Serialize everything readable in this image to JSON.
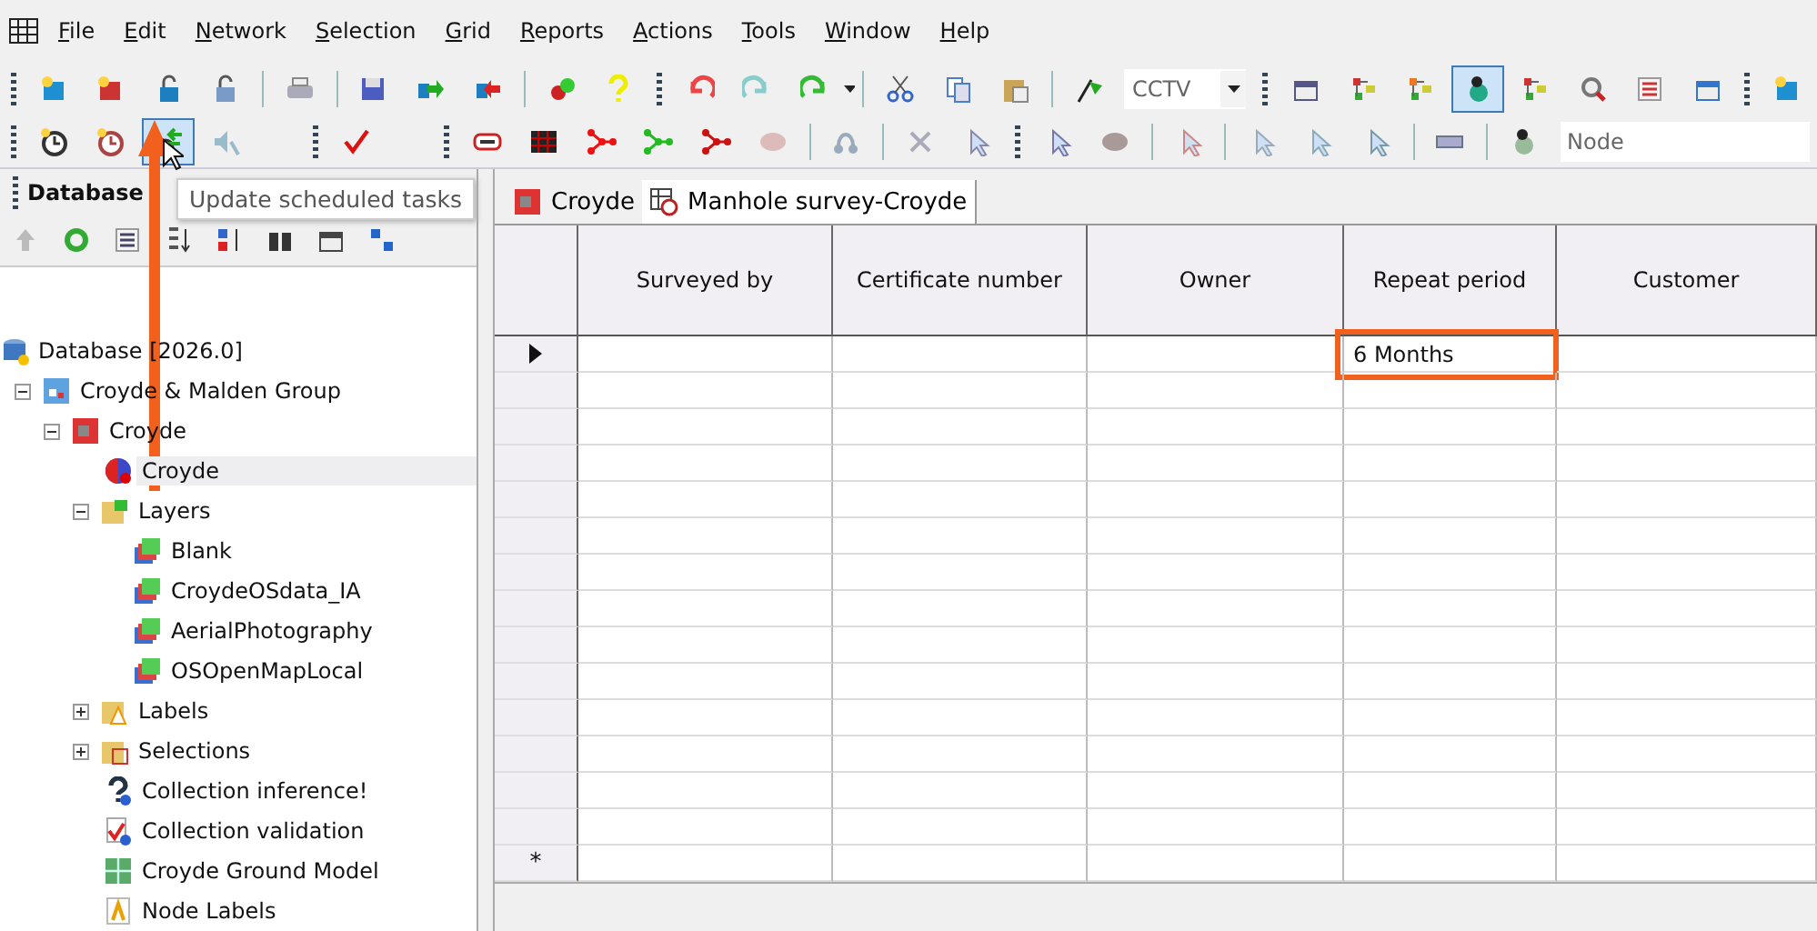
{
  "menu": [
    {
      "label": "File"
    },
    {
      "label": "Edit"
    },
    {
      "label": "Network"
    },
    {
      "label": "Selection"
    },
    {
      "label": "Grid"
    },
    {
      "label": "Reports"
    },
    {
      "label": "Actions"
    },
    {
      "label": "Tools"
    },
    {
      "label": "Window"
    },
    {
      "label": "Help"
    }
  ],
  "toolbars": [
    {
      "items": [
        {
          "kind": "grip"
        },
        {
          "kind": "button",
          "pressed": false
        },
        {
          "kind": "button",
          "pressed": false
        },
        {
          "kind": "button",
          "pressed": false
        },
        {
          "kind": "button",
          "pressed": false
        },
        {
          "kind": "separator"
        },
        {
          "kind": "button",
          "pressed": false
        },
        {
          "kind": "separator"
        },
        {
          "kind": "button",
          "pressed": false
        },
        {
          "kind": "button",
          "pressed": false
        },
        {
          "kind": "button",
          "pressed": false
        },
        {
          "kind": "separator"
        },
        {
          "kind": "button",
          "pressed": false
        },
        {
          "kind": "button",
          "pressed": false
        },
        {
          "kind": "grip"
        },
        {
          "kind": "button",
          "pressed": false
        },
        {
          "kind": "button",
          "pressed": false
        },
        {
          "kind": "dropdown",
          "pressed": false
        },
        {
          "kind": "separator"
        },
        {
          "kind": "button",
          "pressed": false
        },
        {
          "kind": "button",
          "pressed": false
        },
        {
          "kind": "button",
          "pressed": false
        },
        {
          "kind": "separator"
        },
        {
          "kind": "button",
          "pressed": false
        },
        {
          "kind": "combo",
          "value": "CCTV"
        },
        {
          "kind": "grip"
        },
        {
          "kind": "button",
          "pressed": false
        },
        {
          "kind": "button",
          "pressed": false
        },
        {
          "kind": "button",
          "pressed": false
        },
        {
          "kind": "button",
          "pressed": true
        },
        {
          "kind": "button",
          "pressed": false
        },
        {
          "kind": "button",
          "pressed": false
        },
        {
          "kind": "button",
          "pressed": false
        },
        {
          "kind": "button",
          "pressed": false
        },
        {
          "kind": "grip"
        },
        {
          "kind": "button",
          "pressed": false
        }
      ]
    },
    {
      "items": [
        {
          "kind": "grip"
        },
        {
          "kind": "button",
          "pressed": false
        },
        {
          "kind": "button",
          "pressed": false
        },
        {
          "kind": "button",
          "pressed": true
        },
        {
          "kind": "button",
          "pressed": false
        },
        {
          "kind": "gap"
        },
        {
          "kind": "grip"
        },
        {
          "kind": "button",
          "pressed": false
        },
        {
          "kind": "gap"
        },
        {
          "kind": "grip"
        },
        {
          "kind": "button",
          "pressed": false
        },
        {
          "kind": "button",
          "pressed": false
        },
        {
          "kind": "button",
          "pressed": false
        },
        {
          "kind": "button",
          "pressed": false
        },
        {
          "kind": "button",
          "pressed": false
        },
        {
          "kind": "button",
          "pressed": false
        },
        {
          "kind": "separator"
        },
        {
          "kind": "button",
          "pressed": false
        },
        {
          "kind": "separator"
        },
        {
          "kind": "button",
          "pressed": false
        },
        {
          "kind": "button",
          "pressed": false
        },
        {
          "kind": "grip"
        },
        {
          "kind": "button",
          "pressed": false
        },
        {
          "kind": "button",
          "pressed": false
        },
        {
          "kind": "separator"
        },
        {
          "kind": "button",
          "pressed": false
        },
        {
          "kind": "separator"
        },
        {
          "kind": "button",
          "pressed": false
        },
        {
          "kind": "button",
          "pressed": false
        },
        {
          "kind": "button",
          "pressed": false
        },
        {
          "kind": "separator"
        },
        {
          "kind": "button",
          "pressed": false
        },
        {
          "kind": "separator"
        },
        {
          "kind": "button",
          "pressed": false
        },
        {
          "kind": "combo",
          "value": "Node"
        }
      ]
    }
  ],
  "tooltip": {
    "text": "Update scheduled tasks"
  },
  "sidebar": {
    "title": "Database",
    "tree": [
      {
        "label": "Database [2026.0]",
        "kind": "database",
        "children": [
          {
            "label": "Croyde & Malden Group",
            "kind": "group",
            "expanded": true,
            "children": [
              {
                "label": "Croyde",
                "kind": "network",
                "expanded": true,
                "children": [
                  {
                    "label": "Croyde",
                    "kind": "network-item",
                    "selected": true
                  },
                  {
                    "label": "Layers",
                    "kind": "layers-folder",
                    "expanded": true,
                    "children": [
                      {
                        "label": "Blank",
                        "kind": "layer"
                      },
                      {
                        "label": "CroydeOSdata_IA",
                        "kind": "layer"
                      },
                      {
                        "label": "AerialPhotography",
                        "kind": "layer"
                      },
                      {
                        "label": "OSOpenMapLocal",
                        "kind": "layer"
                      }
                    ]
                  },
                  {
                    "label": "Labels",
                    "kind": "labels-folder",
                    "expanded": false
                  },
                  {
                    "label": "Selections",
                    "kind": "selections-folder",
                    "expanded": false
                  },
                  {
                    "label": "Collection inference!",
                    "kind": "inference"
                  },
                  {
                    "label": "Collection validation",
                    "kind": "validation"
                  },
                  {
                    "label": "Croyde Ground Model",
                    "kind": "ground-model"
                  },
                  {
                    "label": "Node Labels",
                    "kind": "node-labels"
                  }
                ]
              }
            ]
          }
        ]
      }
    ]
  },
  "tabs": [
    {
      "label": "Croyde",
      "kind": "network",
      "selected": false
    },
    {
      "label": "Manhole survey-Croyde",
      "kind": "survey",
      "selected": true
    }
  ],
  "grid": {
    "columns": [
      {
        "label": "Surveyed by"
      },
      {
        "label": "Certificate number"
      },
      {
        "label": "Owner"
      },
      {
        "label": "Repeat period"
      },
      {
        "label": "Customer"
      }
    ],
    "rows": [
      {
        "current": true,
        "cells": [
          {
            "highlighted": false
          },
          {
            "highlighted": false
          },
          {
            "highlighted": false
          },
          {
            "text": "6 Months",
            "highlighted": true
          },
          {
            "highlighted": false
          }
        ]
      }
    ],
    "new_row_marker": "*"
  }
}
